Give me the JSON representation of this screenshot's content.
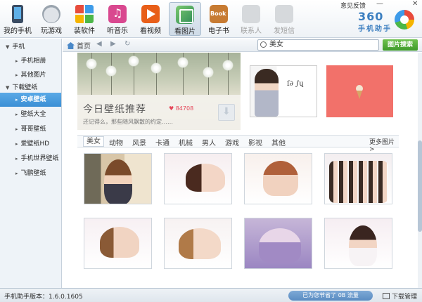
{
  "window": {
    "feedback": "意见反馈",
    "minimize": "—",
    "close": "✕"
  },
  "brand": {
    "number": "360",
    "name": "手机助手"
  },
  "toolbar": {
    "items": [
      {
        "label": "我的手机",
        "icon": "phone-icon"
      },
      {
        "label": "玩游戏",
        "icon": "gamepad-icon"
      },
      {
        "label": "装软件",
        "icon": "apps-icon"
      },
      {
        "label": "听音乐",
        "icon": "music-icon"
      },
      {
        "label": "看视频",
        "icon": "video-icon"
      },
      {
        "label": "看图片",
        "icon": "picture-icon"
      },
      {
        "label": "电子书",
        "icon": "ebook-icon"
      },
      {
        "label": "联系人",
        "icon": "contacts-icon"
      },
      {
        "label": "发短信",
        "icon": "sms-icon"
      }
    ],
    "active_index": 5
  },
  "sidebar": {
    "groups": [
      {
        "label": "手机",
        "items": [
          "手机相册",
          "其他图片"
        ]
      },
      {
        "label": "下载壁纸",
        "items": [
          "安卓壁纸",
          "壁纸大全",
          "哥哥壁纸",
          "爱壁纸HD",
          "手机世界壁纸",
          "飞鹏壁纸"
        ]
      }
    ],
    "selected": "安卓壁纸"
  },
  "nav": {
    "home_label": "首页",
    "back": "◀",
    "forward": "▶",
    "refresh": "↻",
    "search_value": "美女",
    "search_button": "图片搜索"
  },
  "featured": {
    "title": "今日壁纸推荐",
    "likes": "84708",
    "subtitle": "还记得么，那些随风飘散的约定……"
  },
  "categories": {
    "tabs": [
      "美女",
      "动物",
      "风景",
      "卡通",
      "机械",
      "男人",
      "游戏",
      "影视",
      "其他"
    ],
    "active": "美女",
    "more": "更多图片 >"
  },
  "status": {
    "version": "手机助手版本：1.6.0.1605",
    "saved": "已为您节省了 0B 流量",
    "download_manager": "下载管理"
  }
}
